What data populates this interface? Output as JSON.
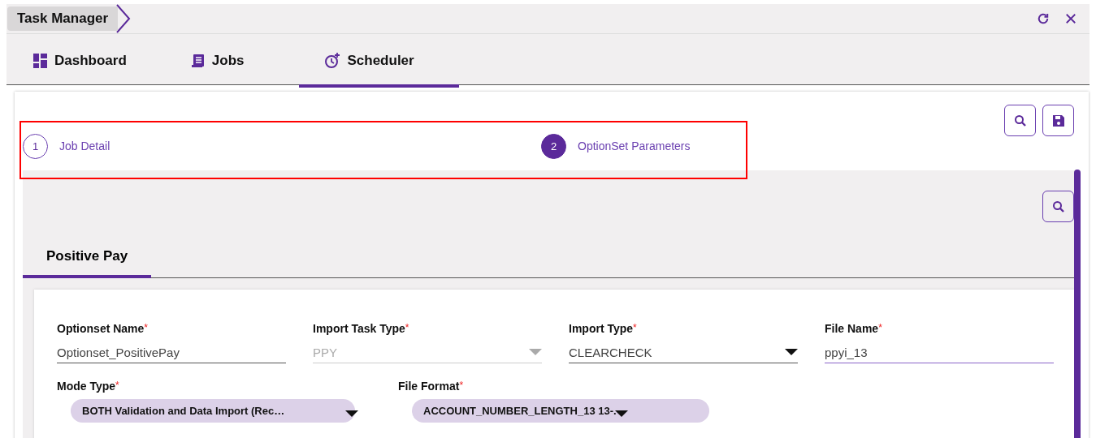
{
  "breadcrumb": {
    "title": "Task Manager"
  },
  "tabs": [
    {
      "label": "Dashboard",
      "selected": false
    },
    {
      "label": "Jobs",
      "selected": false
    },
    {
      "label": "Scheduler",
      "selected": true
    }
  ],
  "steps": [
    {
      "number": "1",
      "label": "Job Detail",
      "selected": false
    },
    {
      "number": "2",
      "label": "OptionSet Parameters",
      "selected": true
    }
  ],
  "section_tabs": [
    {
      "label": "Positive Pay",
      "selected": true
    }
  ],
  "fields_row_1": [
    {
      "kind": "text",
      "label": "Optionset Name",
      "required_mark": "*",
      "value": "Optionset_PositivePay",
      "disabled": false,
      "focused": false
    },
    {
      "kind": "select",
      "label": "Import Task Type",
      "required_mark": "*",
      "value": "PPY",
      "disabled": true,
      "focused": false
    },
    {
      "kind": "select",
      "label": "Import Type",
      "required_mark": "*",
      "value": "CLEARCHECK",
      "disabled": false,
      "focused": false
    },
    {
      "kind": "text",
      "label": "File Name",
      "required_mark": "*",
      "value": "ppyi_13",
      "disabled": false,
      "focused": true
    }
  ],
  "fields_row_2": [
    {
      "kind": "pill",
      "label": "Mode Type",
      "required_mark": "*",
      "value": "BOTH Validation and Data Import (Rec…"
    },
    {
      "kind": "pill",
      "label": "File Format",
      "required_mark": "*",
      "value": "ACCOUNT_NUMBER_LENGTH_13 13-."
    }
  ]
}
